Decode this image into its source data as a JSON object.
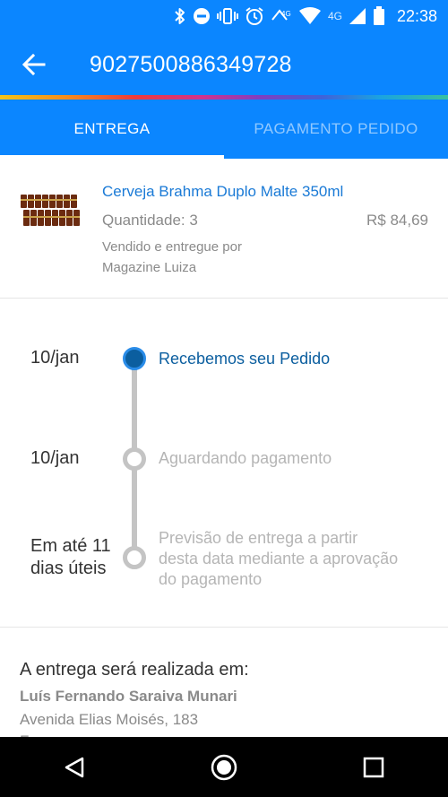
{
  "status_bar": {
    "time": "22:38",
    "network_label": "4G",
    "icons": [
      "bluetooth-icon",
      "do-not-disturb-icon",
      "vibrate-icon",
      "alarm-icon",
      "wifi-4g-icon",
      "wifi-icon",
      "signal-icon",
      "battery-icon"
    ]
  },
  "app_bar": {
    "title": "9027500886349728",
    "back_icon": "arrow-left-icon"
  },
  "tabs": [
    {
      "label": "ENTREGA",
      "active": true
    },
    {
      "label": "PAGAMENTO PEDIDO",
      "active": false
    }
  ],
  "product": {
    "name": "Cerveja Brahma Duplo Malte 350ml",
    "quantity": "Quantidade: 3",
    "price": "R$ 84,69",
    "seller_label": "Vendido e entregue por",
    "seller": "Magazine Luiza"
  },
  "timeline": [
    {
      "date": "10/jan",
      "status": "Recebemos seu Pedido",
      "state": "done"
    },
    {
      "date": "10/jan",
      "status": "Aguardando pagamento",
      "state": "pending"
    },
    {
      "date_line1": "Em até 11",
      "date_line2": "dias úteis",
      "status_line1": "Previsão de entrega a partir",
      "status_line2": "desta data mediante a aprovação",
      "status_line3": "do pagamento",
      "state": "pending"
    }
  ],
  "address": {
    "heading": "A entrega será realizada em:",
    "name": "Luís Fernando Saraiva Munari",
    "street": "Avenida Elias Moisés, 183",
    "city": "Franca"
  },
  "colors": {
    "primary": "#0b86ff",
    "timeline_active": "#0b5e9f",
    "link_text": "#1a7ad6",
    "muted_text": "#8a8a8a"
  }
}
